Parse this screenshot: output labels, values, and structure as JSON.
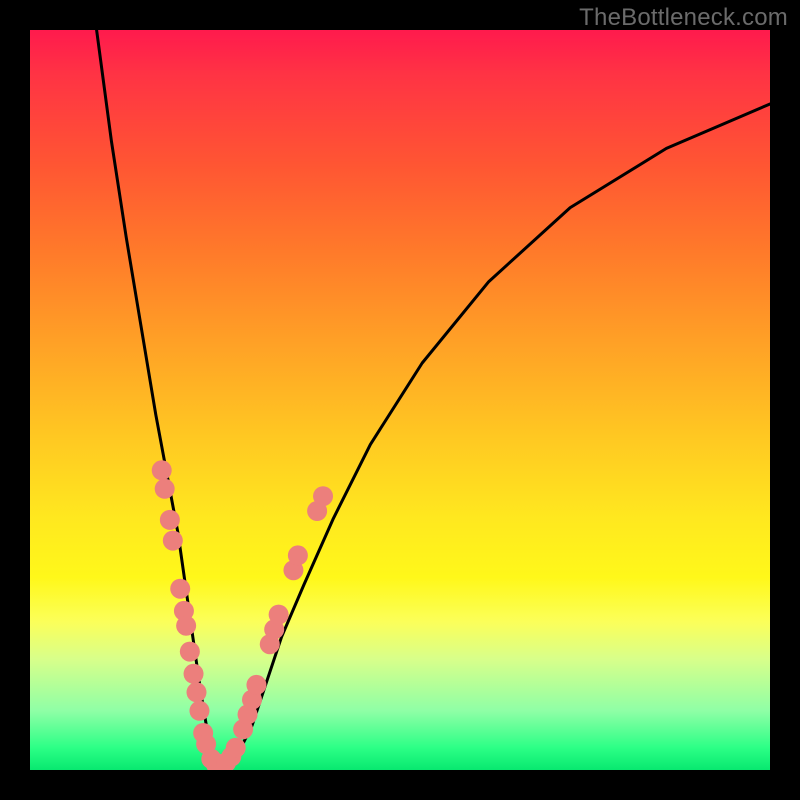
{
  "watermark": "TheBottleneck.com",
  "colors": {
    "frame": "#000000",
    "curve_stroke": "#000000",
    "dot_fill": "#ec7f7c",
    "dot_stroke": "#d86e6a",
    "gradient_stops": [
      {
        "offset": 0.0,
        "color": "#ff1a4d"
      },
      {
        "offset": 0.06,
        "color": "#ff3344"
      },
      {
        "offset": 0.18,
        "color": "#ff5533"
      },
      {
        "offset": 0.3,
        "color": "#ff7a2a"
      },
      {
        "offset": 0.42,
        "color": "#ffa026"
      },
      {
        "offset": 0.55,
        "color": "#ffc822"
      },
      {
        "offset": 0.66,
        "color": "#ffe81f"
      },
      {
        "offset": 0.74,
        "color": "#fff81a"
      },
      {
        "offset": 0.8,
        "color": "#fbff5a"
      },
      {
        "offset": 0.85,
        "color": "#d8ff8a"
      },
      {
        "offset": 0.92,
        "color": "#8fffa6"
      },
      {
        "offset": 0.97,
        "color": "#2cff86"
      },
      {
        "offset": 1.0,
        "color": "#08e870"
      }
    ]
  },
  "chart_data": {
    "type": "line",
    "title": "",
    "xlabel": "",
    "ylabel": "",
    "xlim": [
      0,
      100
    ],
    "ylim": [
      0,
      100
    ],
    "series": [
      {
        "name": "bottleneck-curve",
        "note": "V-shaped curve; y≈100 is top (red), y≈0 is bottom (green). Values estimated from pixels.",
        "x": [
          9,
          11,
          13,
          15,
          17,
          18.5,
          20,
          21,
          22,
          23,
          24,
          25,
          26,
          28,
          30,
          32,
          34,
          37,
          41,
          46,
          53,
          62,
          73,
          86,
          100
        ],
        "y": [
          100,
          85,
          72,
          60,
          48,
          40,
          32,
          25,
          18,
          11,
          5,
          1,
          0.5,
          2,
          6,
          12,
          18,
          25,
          34,
          44,
          55,
          66,
          76,
          84,
          90
        ]
      }
    ],
    "scatter_overlay": {
      "name": "highlight-dots",
      "note": "Pink dots clustered along lower part of the V.",
      "points_xy": [
        [
          17.8,
          40.5
        ],
        [
          18.2,
          38.0
        ],
        [
          18.9,
          33.8
        ],
        [
          19.3,
          31.0
        ],
        [
          20.3,
          24.5
        ],
        [
          20.8,
          21.5
        ],
        [
          21.1,
          19.5
        ],
        [
          21.6,
          16.0
        ],
        [
          22.1,
          13.0
        ],
        [
          22.5,
          10.5
        ],
        [
          22.9,
          8.0
        ],
        [
          23.4,
          5.0
        ],
        [
          23.8,
          3.5
        ],
        [
          24.5,
          1.5
        ],
        [
          25.1,
          0.8
        ],
        [
          25.8,
          0.8
        ],
        [
          26.5,
          1.0
        ],
        [
          27.2,
          1.8
        ],
        [
          27.8,
          3.0
        ],
        [
          28.8,
          5.5
        ],
        [
          29.4,
          7.5
        ],
        [
          30.0,
          9.5
        ],
        [
          30.6,
          11.5
        ],
        [
          32.4,
          17.0
        ],
        [
          33.0,
          19.0
        ],
        [
          33.6,
          21.0
        ],
        [
          35.6,
          27.0
        ],
        [
          36.2,
          29.0
        ],
        [
          38.8,
          35.0
        ],
        [
          39.6,
          37.0
        ]
      ]
    }
  }
}
